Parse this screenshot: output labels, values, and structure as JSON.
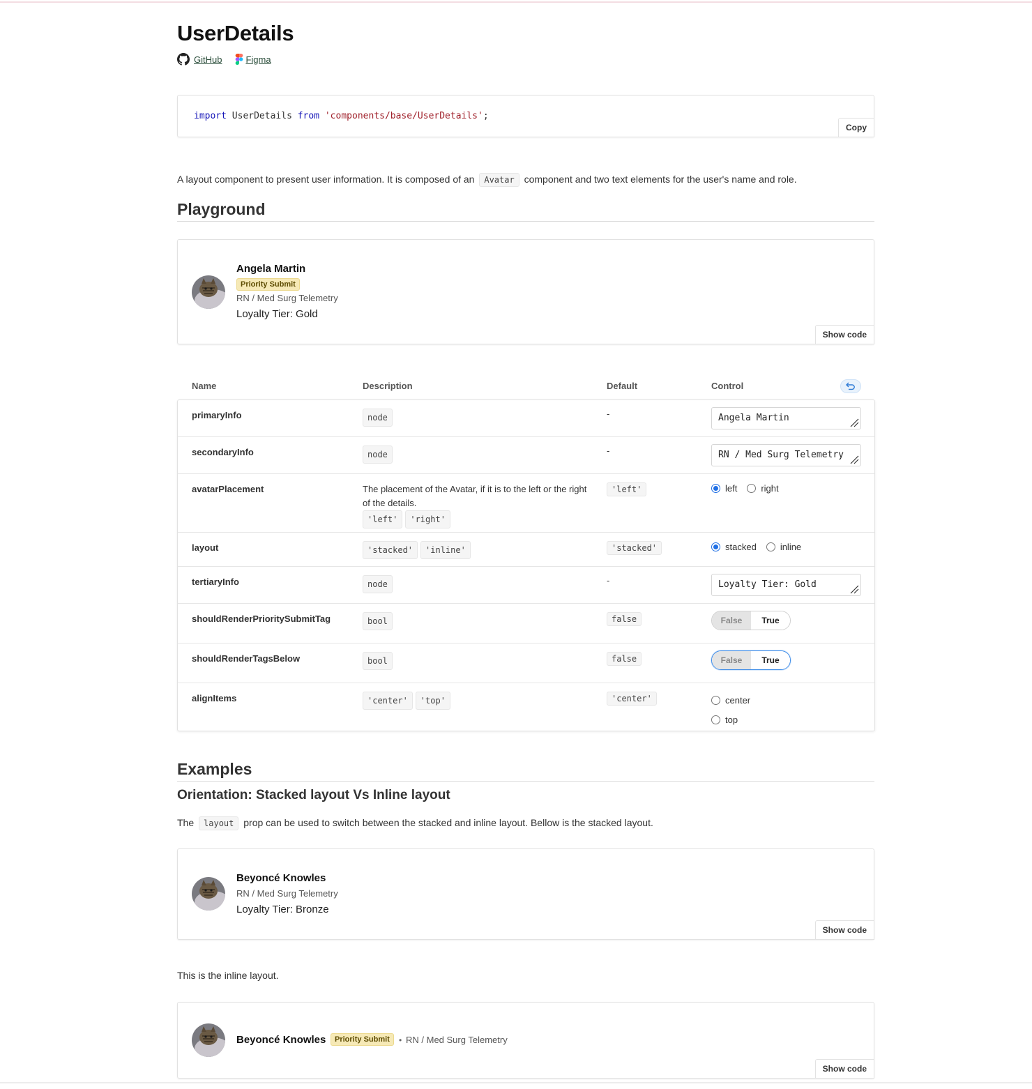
{
  "page": {
    "title": "UserDetails",
    "links": {
      "github": "GitHub",
      "figma": "Figma"
    },
    "import_code": {
      "keyword_import": "import",
      "identifier": "UserDetails",
      "keyword_from": "from",
      "path": "'components/base/UserDetails'",
      "semicolon": ";"
    },
    "copy_label": "Copy",
    "description": {
      "before": "A layout component to present user information. It is composed of an",
      "chip": "Avatar",
      "after": "component and two text elements for the user's name and role."
    }
  },
  "playground": {
    "heading": "Playground",
    "preview": {
      "name": "Angela Martin",
      "tag": "Priority Submit",
      "secondary": "RN / Med Surg Telemetry",
      "tertiary": "Loyalty Tier: Gold"
    },
    "show_code_label": "Show code"
  },
  "props_table": {
    "headers": {
      "name": "Name",
      "description": "Description",
      "default": "Default",
      "control": "Control"
    },
    "rows": [
      {
        "name": "primaryInfo",
        "desc_text": "",
        "chips": [
          "node"
        ],
        "default": "-",
        "control": {
          "type": "text",
          "value": "Angela Martin"
        }
      },
      {
        "name": "secondaryInfo",
        "desc_text": "",
        "chips": [
          "node"
        ],
        "default": "-",
        "control": {
          "type": "text",
          "value": "RN / Med Surg Telemetry"
        }
      },
      {
        "name": "avatarPlacement",
        "desc_text": "The placement of the Avatar, if it is to the left or the right of the details.",
        "chips": [
          "'left'",
          "'right'"
        ],
        "default": "'left'",
        "control": {
          "type": "radio",
          "options": [
            "left",
            "right"
          ],
          "selected": "left"
        }
      },
      {
        "name": "layout",
        "desc_text": "",
        "chips": [
          "'stacked'",
          "'inline'"
        ],
        "default": "'stacked'",
        "control": {
          "type": "radio",
          "options": [
            "stacked",
            "inline"
          ],
          "selected": "stacked"
        }
      },
      {
        "name": "tertiaryInfo",
        "desc_text": "",
        "chips": [
          "node"
        ],
        "default": "-",
        "control": {
          "type": "text",
          "value": "Loyalty Tier: Gold"
        }
      },
      {
        "name": "shouldRenderPrioritySubmitTag",
        "desc_text": "",
        "chips": [
          "bool"
        ],
        "default": "false",
        "control": {
          "type": "toggle",
          "options": [
            "False",
            "True"
          ],
          "selected": "True"
        }
      },
      {
        "name": "shouldRenderTagsBelow",
        "desc_text": "",
        "chips": [
          "bool"
        ],
        "default": "false",
        "control": {
          "type": "toggle",
          "options": [
            "False",
            "True"
          ],
          "selected": "True"
        }
      },
      {
        "name": "alignItems",
        "desc_text": "",
        "chips": [
          "'center'",
          "'top'"
        ],
        "default": "'center'",
        "control": {
          "type": "radio",
          "options": [
            "center",
            "top"
          ],
          "selected": ""
        }
      }
    ]
  },
  "examples": {
    "heading": "Examples",
    "subheading": "Orientation: Stacked layout Vs Inline layout",
    "para1": {
      "before": "The",
      "chip": "layout",
      "after": "prop can be used to switch between the stacked and inline layout. Bellow is the stacked layout."
    },
    "stacked": {
      "name": "Beyoncé Knowles",
      "secondary": "RN / Med Surg Telemetry",
      "tertiary": "Loyalty Tier: Bronze"
    },
    "para2": "This is the inline layout.",
    "inline": {
      "name": "Beyoncé Knowles",
      "tag": "Priority Submit",
      "separator": "•",
      "secondary": "RN / Med Surg Telemetry"
    },
    "show_code_label": "Show code"
  },
  "icons": {
    "github": "github-icon",
    "figma": "figma-icon",
    "reset": "undo-icon",
    "avatar": "cat-photo-avatar"
  },
  "colors": {
    "accent_blue": "#1f6fe5",
    "tag_bg": "#f6e9b6",
    "keyword": "#1515b8",
    "string": "#a0212b"
  }
}
